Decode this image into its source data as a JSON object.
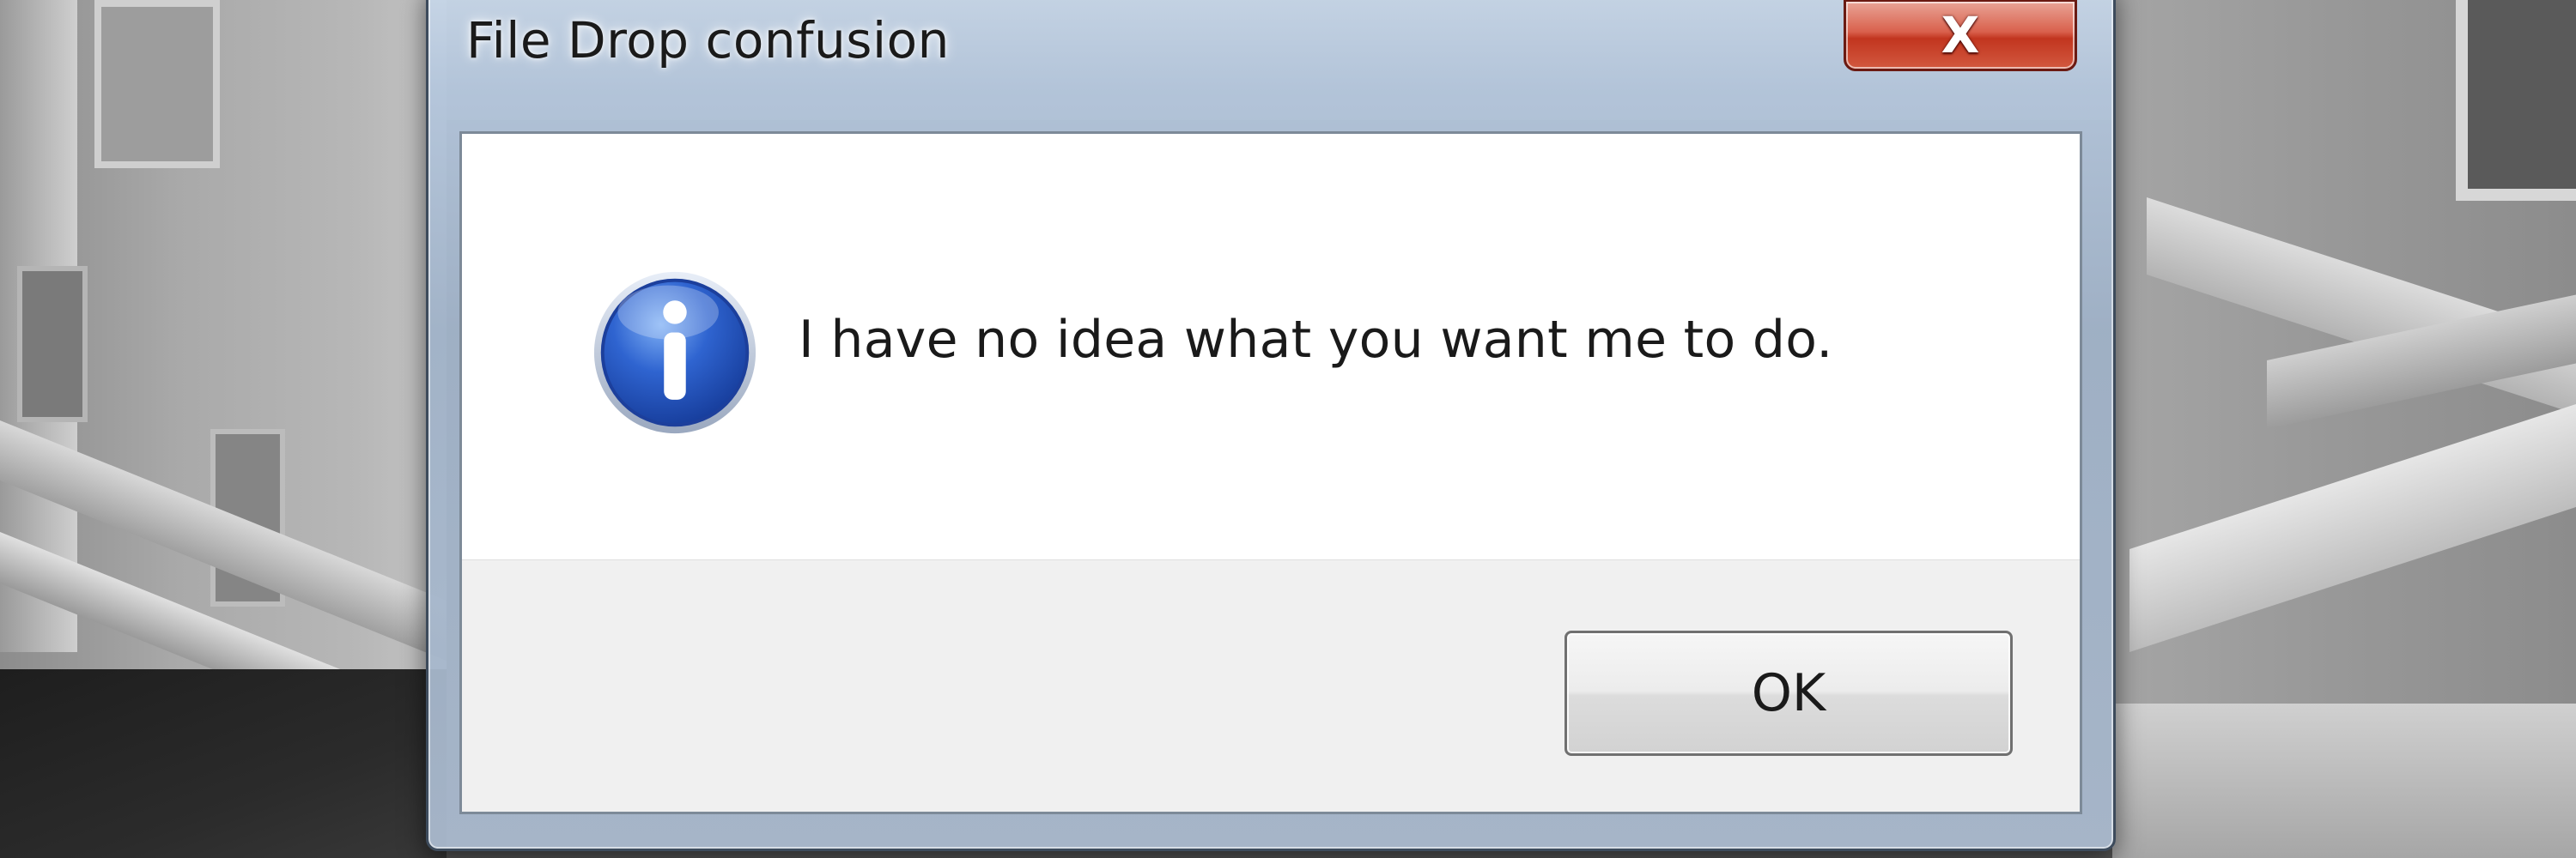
{
  "dialog": {
    "title": "File Drop confusion",
    "close_label": "X",
    "message": "I have no idea what you want me to do.",
    "icon": "information-icon",
    "buttons": {
      "ok_label": "OK"
    }
  },
  "colors": {
    "info_icon_blue": "#1f4fb5",
    "close_button_red": "#c2351f",
    "client_background": "#ffffff",
    "button_area_background": "#f0f0f0"
  }
}
